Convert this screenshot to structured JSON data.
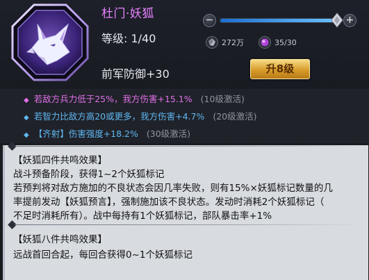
{
  "hero": {
    "name": "杜门·妖狐",
    "level_label": "等级: 1/40",
    "stat_text": "前军防御+30",
    "level_progress_fraction": 1.0
  },
  "resources": [
    {
      "icon": "gem-gray-icon",
      "value": "272万"
    },
    {
      "icon": "gem-purple-icon",
      "value": "35/30"
    }
  ],
  "upgrade_button": {
    "label": "升8级"
  },
  "skills": [
    {
      "icon": "diamond-bullet-icon",
      "text": "若敌方兵力低于25%，我方伤害+15.1%",
      "unlock": "(10级激活)",
      "color": "#e070e8"
    },
    {
      "icon": "diamond-bullet-icon",
      "text": "若智力比敌方高20或更多，我方伤害+4.7%",
      "unlock": "(20级激活)",
      "color": "#5fb7f2"
    },
    {
      "icon": "diamond-bullet-icon",
      "text": "【齐射】伤害强度+18.2%",
      "unlock": "(30级激活)",
      "color": "#5fb7f2"
    }
  ],
  "set_effects": {
    "four": {
      "title": "【妖狐四件共鸣效果】",
      "line1": "战斗预备阶段，获得1~2个妖狐标记",
      "line2": "若预判将对敌方施加的不良状态会因几率失败，则有15%×妖狐标记数量的几",
      "line3": "率提前发动【妖狐预言】，强制施加该不良状态。发动时消耗2个妖狐标记（",
      "line4": "不足时消耗所有）。战中每持有1个妖狐标记，部队暴击率+1%"
    },
    "eight": {
      "title": "【妖狐八件共鸣效果】",
      "line1": "远战首回合起，每回合获得0~1个妖狐标记"
    }
  },
  "colors": {
    "name": "#e880ff",
    "upgrade_gold": "#e0a93a",
    "slider_blue": "#3d9df0"
  }
}
